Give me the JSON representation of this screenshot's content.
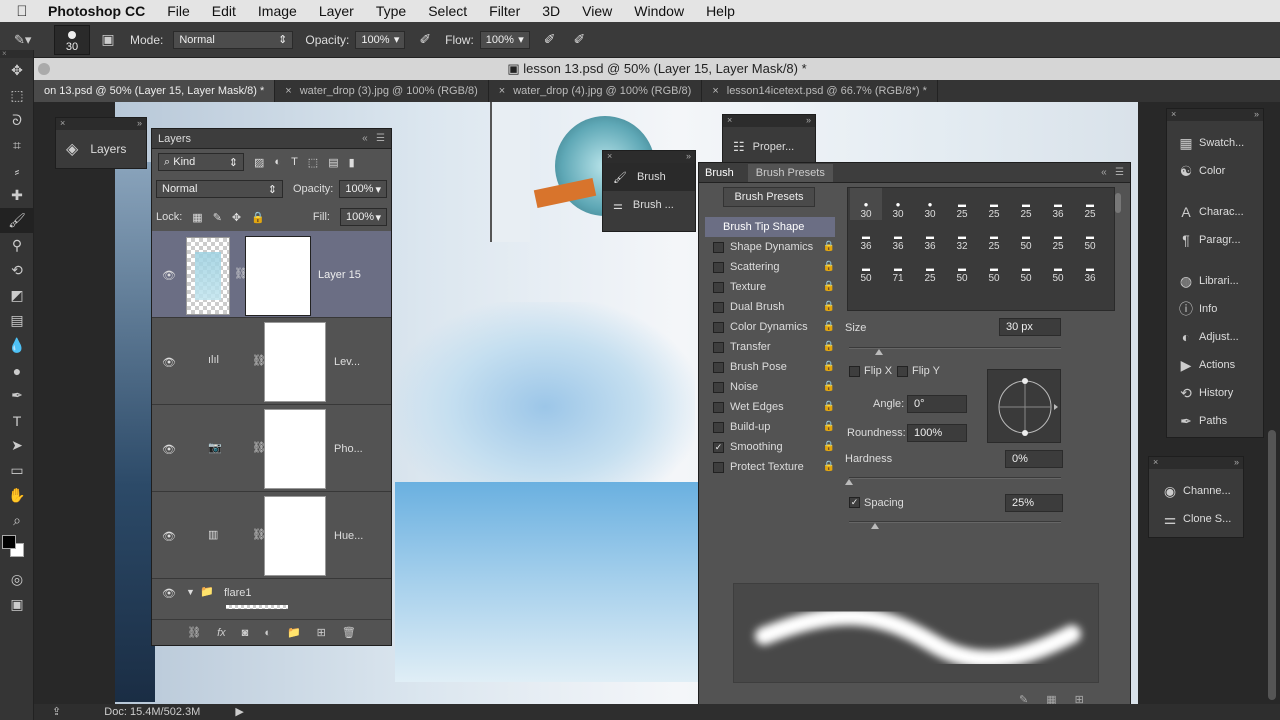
{
  "menubar": {
    "app": "Photoshop CC",
    "items": [
      "File",
      "Edit",
      "Image",
      "Layer",
      "Type",
      "Select",
      "Filter",
      "3D",
      "View",
      "Window",
      "Help"
    ]
  },
  "options": {
    "brush_size": "30",
    "mode_label": "Mode:",
    "mode": "Normal",
    "opacity_label": "Opacity:",
    "opacity": "100%",
    "flow_label": "Flow:",
    "flow": "100%"
  },
  "document": {
    "title": "lesson 13.psd @ 50% (Layer 15, Layer Mask/8) *"
  },
  "tabs": [
    {
      "label": "on 13.psd @ 50% (Layer 15, Layer Mask/8) *",
      "active": true
    },
    {
      "label": "water_drop (3).jpg @ 100% (RGB/8)"
    },
    {
      "label": "water_drop (4).jpg @ 100% (RGB/8)"
    },
    {
      "label": "lesson14icetext.psd @ 66.7% (RGB/8*) *"
    }
  ],
  "status": {
    "doc": "Doc: 15.4M/502.3M"
  },
  "layers_mini": {
    "label": "Layers"
  },
  "layers": {
    "title": "Layers",
    "filter": "Kind",
    "blend": "Normal",
    "opacity_label": "Opacity:",
    "opacity": "100%",
    "lock_label": "Lock:",
    "fill_label": "Fill:",
    "fill": "100%",
    "rows": [
      {
        "name": "Layer 15"
      },
      {
        "name": "Lev..."
      },
      {
        "name": "Pho..."
      },
      {
        "name": "Hue..."
      }
    ],
    "group": "flare1"
  },
  "properties": {
    "label": "Proper..."
  },
  "brush_mini": {
    "items": [
      "Brush",
      "Brush ..."
    ]
  },
  "brush": {
    "tabs": [
      "Brush",
      "Brush Presets"
    ],
    "presets_button": "Brush Presets",
    "tip_shape": "Brush Tip Shape",
    "options": [
      {
        "label": "Shape Dynamics",
        "checked": false
      },
      {
        "label": "Scattering",
        "checked": false
      },
      {
        "label": "Texture",
        "checked": false
      },
      {
        "label": "Dual Brush",
        "checked": false
      },
      {
        "label": "Color Dynamics",
        "checked": false
      },
      {
        "label": "Transfer",
        "checked": false
      },
      {
        "label": "Brush Pose",
        "checked": false
      },
      {
        "label": "Noise",
        "checked": false
      },
      {
        "label": "Wet Edges",
        "checked": false
      },
      {
        "label": "Build-up",
        "checked": false
      },
      {
        "label": "Smoothing",
        "checked": true
      },
      {
        "label": "Protect Texture",
        "checked": false
      }
    ],
    "tip_rows": [
      [
        "30",
        "30",
        "30",
        "25",
        "25",
        "25",
        "36",
        "25"
      ],
      [
        "36",
        "36",
        "36",
        "32",
        "25",
        "50",
        "25",
        "50"
      ],
      [
        "50",
        "71",
        "25",
        "50",
        "50",
        "50",
        "50",
        "36"
      ]
    ],
    "size_label": "Size",
    "size": "30 px",
    "flipx": "Flip X",
    "flipy": "Flip Y",
    "angle_label": "Angle:",
    "angle": "0°",
    "roundness_label": "Roundness:",
    "roundness": "100%",
    "hardness_label": "Hardness",
    "hardness": "0%",
    "spacing_label": "Spacing",
    "spacing": "25%"
  },
  "dock": {
    "items": [
      {
        "label": "Swatch...",
        "icon": "grid-icon"
      },
      {
        "label": "Color",
        "icon": "palette-icon"
      },
      {
        "label": "Charac...",
        "icon": "type-icon"
      },
      {
        "label": "Paragr...",
        "icon": "pilcrow-icon"
      },
      {
        "label": "Librari...",
        "icon": "libraries-icon"
      },
      {
        "label": "Info",
        "icon": "info-icon"
      },
      {
        "label": "Adjust...",
        "icon": "adjust-icon"
      },
      {
        "label": "Actions",
        "icon": "play-icon"
      },
      {
        "label": "History",
        "icon": "history-icon"
      },
      {
        "label": "Paths",
        "icon": "paths-icon"
      }
    ]
  },
  "dock2": {
    "items": [
      {
        "label": "Channe..."
      },
      {
        "label": "Clone S..."
      }
    ]
  }
}
